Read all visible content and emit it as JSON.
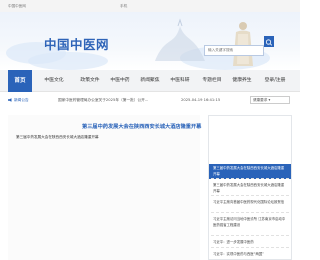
{
  "topbar": {
    "left_text": "中国中医网",
    "right_text": "手机"
  },
  "banner": {
    "logo_text": "中国中医网",
    "search": {
      "placeholder": "输入关键字搜索"
    }
  },
  "nav": {
    "items": [
      {
        "label": "首页",
        "active": true
      },
      {
        "label": "中医文化",
        "active": false
      },
      {
        "label": "政策文件",
        "active": false
      },
      {
        "label": "中医中药",
        "active": false
      },
      {
        "label": "新闻聚焦",
        "active": false
      },
      {
        "label": "中医科研",
        "active": false
      },
      {
        "label": "专题栏目",
        "active": false
      },
      {
        "label": "健康养生",
        "active": false
      },
      {
        "label": "登录/注册",
        "active": false
      }
    ]
  },
  "ticker": {
    "label": "新闻公告",
    "text": "国家中医药管理局办公室关于2025年（第一批）公开...",
    "date": "2025-04-19 16:41:15",
    "select_value": "健康要求 ▾"
  },
  "news": {
    "main_title": "第三届中药发展大会在陕西西安长城大酒店隆重开幕",
    "main_sub": "第三届中药发展大会在陕西西安长城大酒店隆重开幕",
    "side_items": [
      {
        "text": "第三届中药发展大会在陕西西安长城大酒店隆重开幕",
        "active": true
      },
      {
        "text": "第三届中药发展大会在陕西西安长城大酒店隆重开幕",
        "active": false
      },
      {
        "text": "习近平主席向首届中医药现代化国际论坛致贺信",
        "active": false
      },
      {
        "text": "习近平主席访问当地中医诊所 江苏南京市启动中医药强省工程建设",
        "active": false
      },
      {
        "text": "习近平：进一步发展中医药",
        "active": false
      },
      {
        "text": "习近平：实现中医药与西医“两翼”",
        "active": false
      }
    ]
  }
}
